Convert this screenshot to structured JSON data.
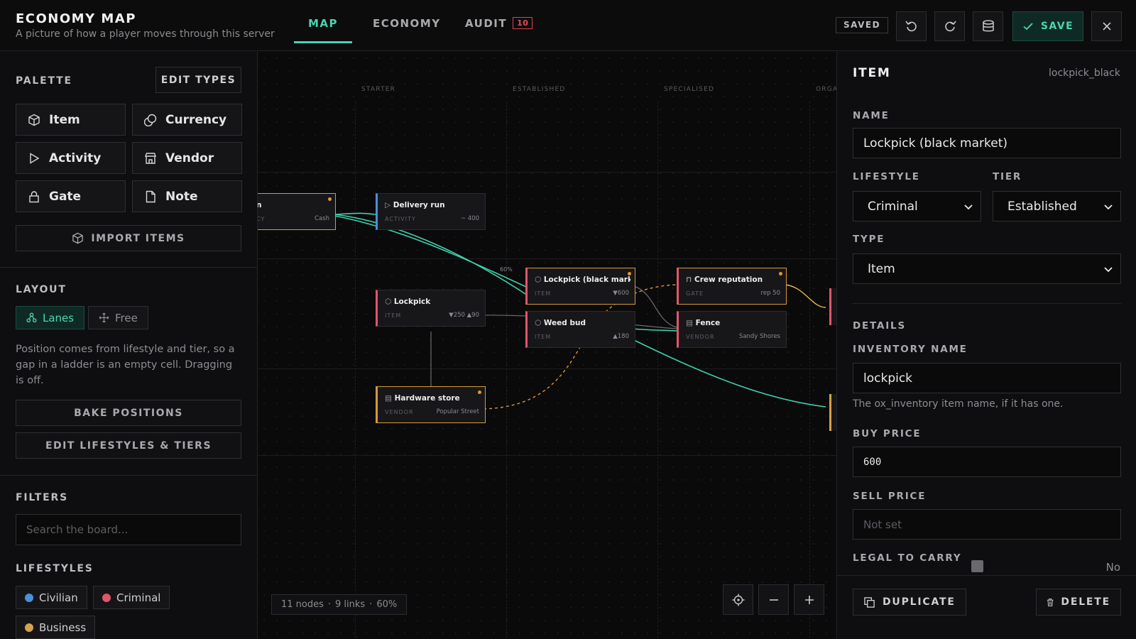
{
  "header": {
    "title": "ECONOMY MAP",
    "subtitle": "A picture of how a player moves through this server",
    "tabs": [
      {
        "label": "MAP"
      },
      {
        "label": "ECONOMY"
      },
      {
        "label": "AUDIT",
        "badge": "10"
      }
    ],
    "active_tab": "MAP",
    "saved_label": "SAVED",
    "save_label": "SAVE",
    "accent": "#46d3b0"
  },
  "sidebar": {
    "palette_label": "PALETTE",
    "edit_types_label": "EDIT TYPES",
    "palette_items": [
      {
        "label": "Item",
        "icon": "cube-icon"
      },
      {
        "label": "Currency",
        "icon": "coins-icon"
      },
      {
        "label": "Activity",
        "icon": "play-icon"
      },
      {
        "label": "Vendor",
        "icon": "store-icon"
      },
      {
        "label": "Gate",
        "icon": "lock-icon"
      },
      {
        "label": "Note",
        "icon": "note-icon"
      }
    ],
    "import_label": "IMPORT ITEMS",
    "layout_label": "LAYOUT",
    "layout_options": [
      {
        "label": "Lanes",
        "active": true
      },
      {
        "label": "Free",
        "active": false
      }
    ],
    "layout_description": "Position comes from lifestyle and tier, so a gap in a ladder is an empty cell. Dragging is off.",
    "bake_label": "BAKE POSITIONS",
    "edit_lifestyles_label": "EDIT LIFESTYLES & TIERS",
    "filters_label": "FILTERS",
    "search_placeholder": "Search the board...",
    "lifestyles_label": "LIFESTYLES",
    "lifestyles": [
      {
        "label": "Civilian",
        "color": "#4a90d9"
      },
      {
        "label": "Criminal",
        "color": "#e0566a"
      },
      {
        "label": "Business",
        "color": "#d4a24a"
      }
    ]
  },
  "canvas": {
    "lanes": [
      "STARTER",
      "ESTABLISHED",
      "SPECIALISED",
      "ORGA"
    ],
    "edge_label": "60%",
    "nodes": [
      {
        "id": "cash",
        "title": "n",
        "kind": "CY",
        "meta": "Cash"
      },
      {
        "id": "delivery",
        "title": "Delivery run",
        "kind": "ACTIVITY",
        "meta": "~ 400"
      },
      {
        "id": "lockpick",
        "title": "Lockpick",
        "kind": "ITEM",
        "meta": "▼250 ▲90"
      },
      {
        "id": "hardware",
        "title": "Hardware store",
        "kind": "VENDOR",
        "meta": "Popular Street"
      },
      {
        "id": "lockpick_black",
        "title": "Lockpick (black mark...",
        "kind": "ITEM",
        "meta": "▼600"
      },
      {
        "id": "weed",
        "title": "Weed bud",
        "kind": "ITEM",
        "meta": "▲180"
      },
      {
        "id": "crew",
        "title": "Crew reputation",
        "kind": "GATE",
        "meta": "rep 50"
      },
      {
        "id": "fence",
        "title": "Fence",
        "kind": "VENDOR",
        "meta": "Sandy Shores"
      }
    ],
    "status": {
      "nodes": "11 nodes",
      "links": "9 links",
      "zoom": "60%"
    }
  },
  "panel": {
    "title": "ITEM",
    "id": "lockpick_black",
    "name_label": "NAME",
    "name_value": "Lockpick (black market)",
    "lifestyle_label": "LIFESTYLE",
    "lifestyle_value": "Criminal",
    "tier_label": "TIER",
    "tier_value": "Established",
    "type_label": "TYPE",
    "type_value": "Item",
    "details_label": "DETAILS",
    "inventory_label": "INVENTORY NAME",
    "inventory_value": "lockpick",
    "inventory_help": "The ox_inventory item name, if it has one.",
    "buy_label": "BUY PRICE",
    "buy_value": "600",
    "sell_label": "SELL PRICE",
    "sell_placeholder": "Not set",
    "legal_label": "LEGAL TO CARRY",
    "legal_value": "No",
    "duplicate_label": "DUPLICATE",
    "delete_label": "DELETE"
  }
}
